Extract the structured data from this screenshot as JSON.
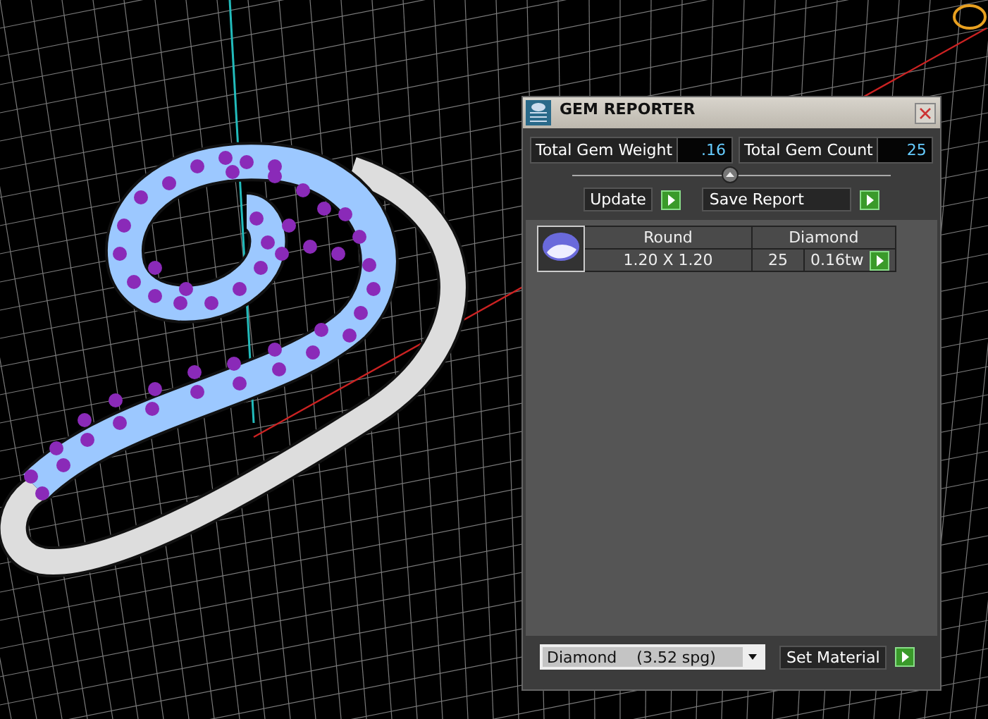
{
  "window": {
    "title": "GEM REPORTER"
  },
  "stats": [
    {
      "label": "Total Gem Weight",
      "value": ".16"
    },
    {
      "label": "Total Gem Count",
      "value": "25"
    }
  ],
  "buttons": [
    "Update",
    "Save Report"
  ],
  "gems": [
    {
      "shape": "Round",
      "material": "Diamond",
      "size": "1.20 X 1.20",
      "count": "25",
      "weight": "0.16tw"
    }
  ],
  "material_select": {
    "value": "Diamond    (3.52 spg)"
  },
  "set_button": "Set Material"
}
